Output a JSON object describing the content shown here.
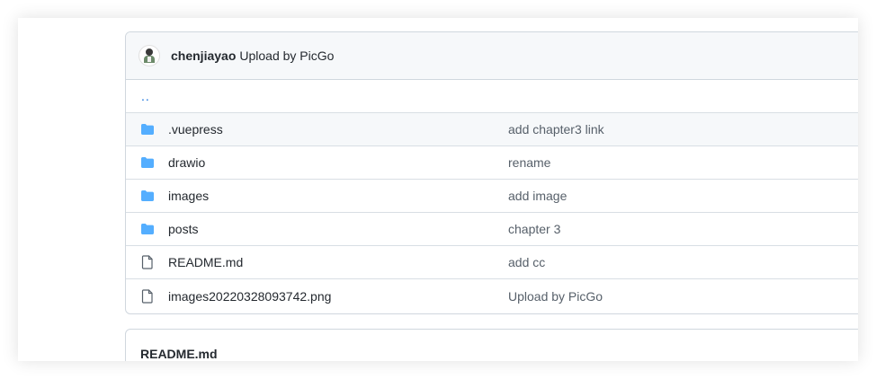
{
  "commit": {
    "author": "chenjiayao",
    "message": "Upload by PicGo"
  },
  "parent_dir": "..",
  "files": [
    {
      "icon": "folder-icon",
      "name": ".vuepress",
      "message": "add chapter3 link",
      "hover": true
    },
    {
      "icon": "folder-icon",
      "name": "drawio",
      "message": "rename"
    },
    {
      "icon": "folder-icon",
      "name": "images",
      "message": "add image"
    },
    {
      "icon": "folder-icon",
      "name": "posts",
      "message": "chapter 3"
    },
    {
      "icon": "file-icon",
      "name": "README.md",
      "message": "add cc"
    },
    {
      "icon": "file-icon",
      "name": "images20220328093742.png",
      "message": "Upload by PicGo"
    }
  ],
  "readme": {
    "title": "README.md"
  },
  "colors": {
    "folder": "#54aeff",
    "link": "#0969da",
    "border": "#d0d7de"
  }
}
